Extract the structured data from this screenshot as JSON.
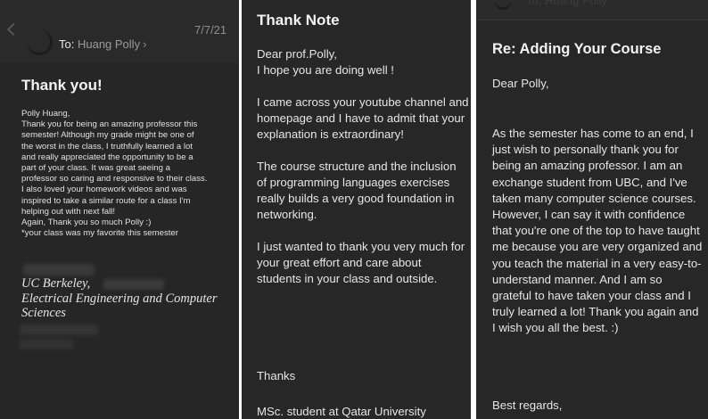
{
  "left_email": {
    "date": "7/7/21",
    "to_label": "To:",
    "to_name": "Huang Polly",
    "subject": "Thank you!",
    "body_lines": [
      "Polly Huang,",
      "Thank you for being an amazing professor this",
      "semester! Although my grade might be one of",
      "the worst in the class, I truthfully learned a lot",
      "and really appreciated the opportunity to be a",
      "part of your class. It was great seeing a",
      "professor so caring and responsive to their class.",
      "I also loved your homework videos and was",
      "inspired to take a similar route for a class I'm",
      "helping out with next fall!",
      "Again, Thank you so much Polly :)",
      "*your class was my favorite this semester"
    ],
    "org_lines": [
      "UC Berkeley,",
      "Electrical Engineering and Computer",
      "Sciences"
    ]
  },
  "middle_note": {
    "title": "Thank Note",
    "paragraphs": [
      "Dear prof.Polly,\nI hope you are doing well !",
      "I came across your youtube channel and homepage and I have to admit that your explanation is extraordinary!",
      "The course structure and the inclusion of programming languages exercises really builds a very good foundation in networking.",
      "I just wanted to thank you very much for your great effort and care about students in your class and outside."
    ],
    "closing": "Thanks",
    "degree": "MSc. student at Qatar University"
  },
  "right_email": {
    "to_clipped": "To: Huang Polly",
    "subject": "Re:  Adding Your Course",
    "greeting": "Dear Polly,",
    "body": "As the semester has come to an end, I just wish to personally thank you for being an amazing professor. I am an exchange student from UBC, and I've taken many computer science courses. However, I can say it with confidence that you're one of the top to have taught me because you are very organized and you teach the material in a very easy-to-understand manner. And I am so grateful to have taken your class and I truly learned a lot! Thank you again and I wish you all the best. :)",
    "regards": "Best regards,"
  },
  "colors": {
    "panel_bg": "#272727",
    "text": "#e6e6e6",
    "muted": "#8f8f8f"
  },
  "icons": [
    "back-chevron-icon",
    "avatar-icon",
    "chevron-right-icon"
  ]
}
